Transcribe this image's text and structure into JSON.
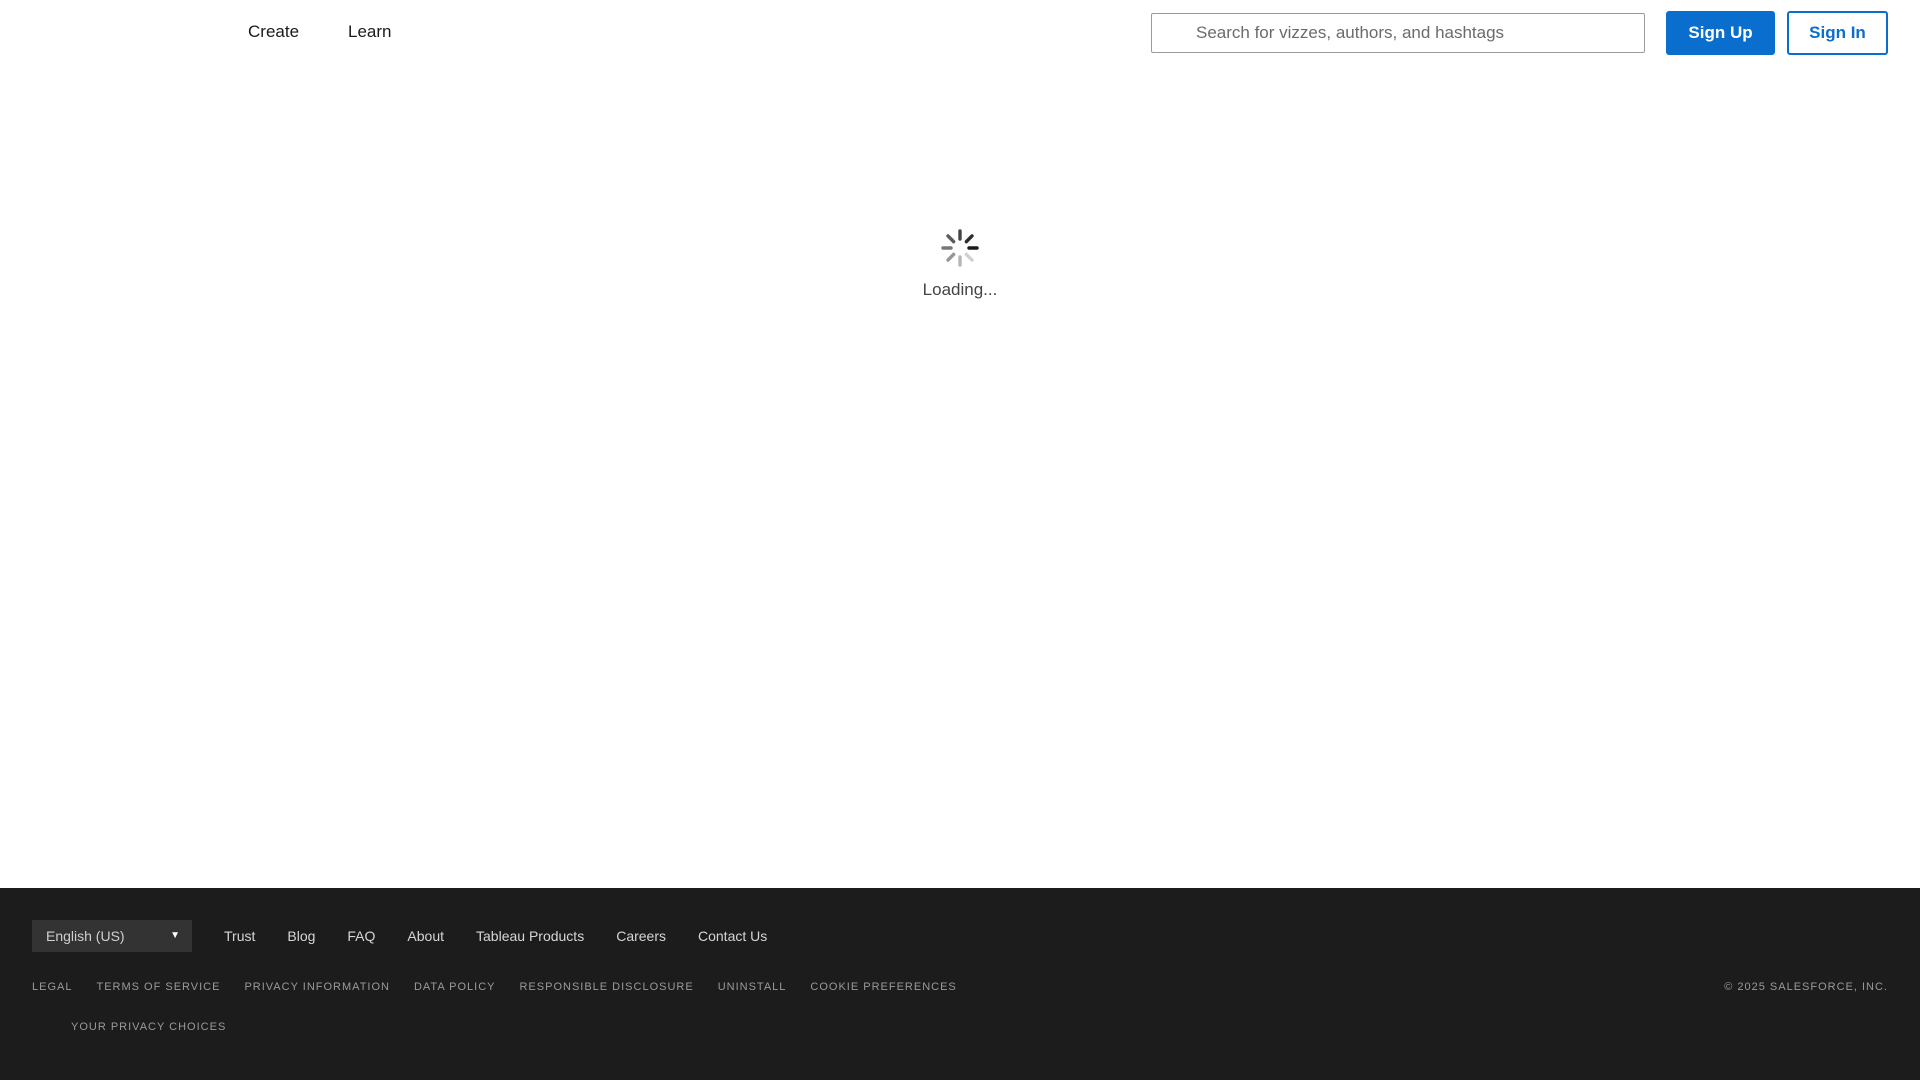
{
  "header": {
    "nav": [
      {
        "label": "Create"
      },
      {
        "label": "Learn"
      }
    ],
    "search": {
      "placeholder": "Search for vizzes, authors, and hashtags",
      "icon": "search-icon"
    },
    "signup_label": "Sign Up",
    "signin_label": "Sign In"
  },
  "main": {
    "loading_text": "Loading..."
  },
  "footer": {
    "language": "English (US)",
    "links": [
      "Trust",
      "Blog",
      "FAQ",
      "About",
      "Tableau Products",
      "Careers",
      "Contact Us"
    ],
    "legal": [
      "LEGAL",
      "TERMS OF SERVICE",
      "PRIVACY INFORMATION",
      "DATA POLICY",
      "RESPONSIBLE DISCLOSURE",
      "UNINSTALL",
      "COOKIE PREFERENCES"
    ],
    "privacy_choices": "YOUR PRIVACY CHOICES",
    "copyright": "© 2025 SALESFORCE, INC."
  },
  "colors": {
    "accent": "#0a6ece",
    "footer_bg": "#1c1c1c"
  }
}
